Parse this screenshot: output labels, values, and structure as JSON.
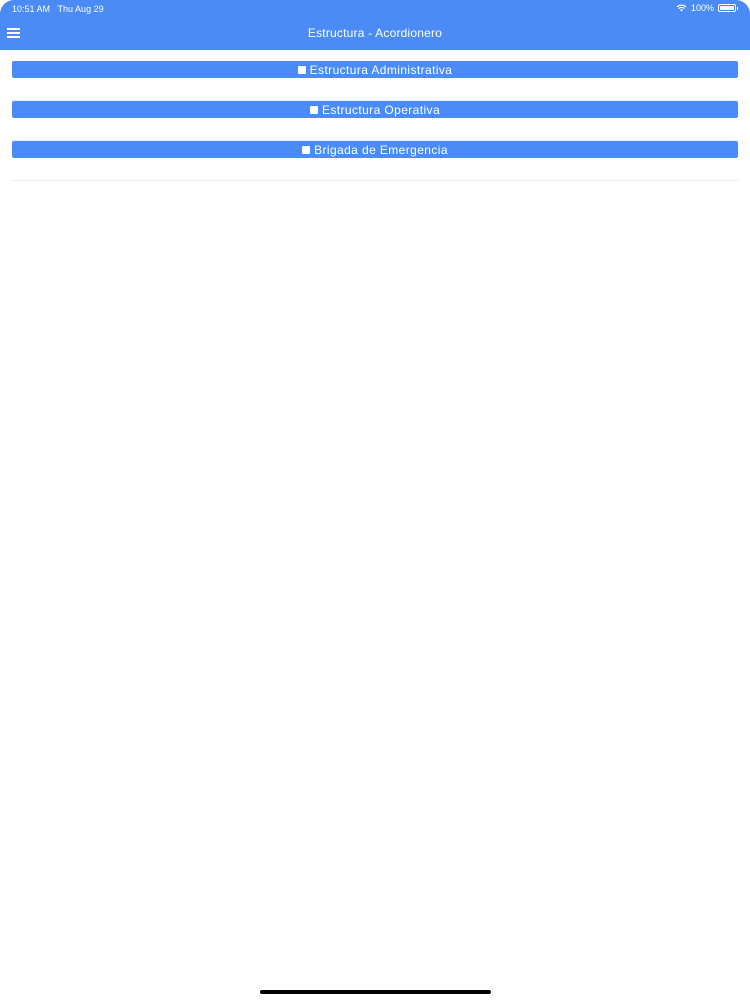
{
  "status_bar": {
    "time": "10:51 AM",
    "date": "Thu Aug 29",
    "battery_percent": "100%",
    "icons": [
      "wifi-icon",
      "battery-icon"
    ]
  },
  "nav": {
    "title": "Estructura - Acordionero",
    "menu_icon": "hamburger-menu-icon"
  },
  "accordion": {
    "items": [
      {
        "label": "Estructura Administrativa",
        "icon": "square-icon"
      },
      {
        "label": "Estructura Operativa",
        "icon": "square-icon"
      },
      {
        "label": "Brigada de Emergencia",
        "icon": "square-icon"
      }
    ]
  },
  "colors": {
    "accent": "#4a8bf5",
    "background": "#ffffff",
    "divider": "#e9edf2"
  }
}
